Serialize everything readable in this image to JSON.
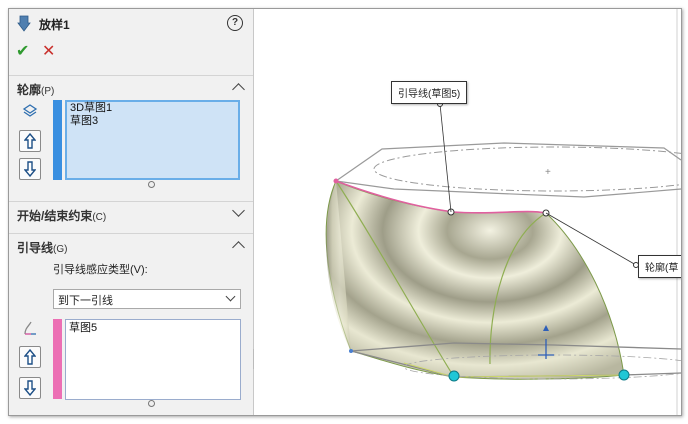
{
  "feature": {
    "title": "放样1",
    "help_label": "?",
    "ok_icon": "check-icon",
    "cancel_icon": "close-icon",
    "accent_color": "#6aaee8"
  },
  "profiles_section": {
    "title": "轮廓",
    "shortcut": "(P)",
    "items": [
      "3D草图1",
      "草图3"
    ],
    "strip_color": "#3a8fe0"
  },
  "constraints_section": {
    "title": "开始/结束约束",
    "shortcut": "(C)"
  },
  "guides_section": {
    "title": "引导线",
    "shortcut": "(G)",
    "influence_label": "引导线感应类型(V):",
    "influence_value": "到下一引线",
    "items": [
      "草图5"
    ],
    "strip_color": "#ec6fb4"
  },
  "viewport": {
    "callout_guide": "引导线(草图5)",
    "callout_profile": "轮廓(草"
  }
}
